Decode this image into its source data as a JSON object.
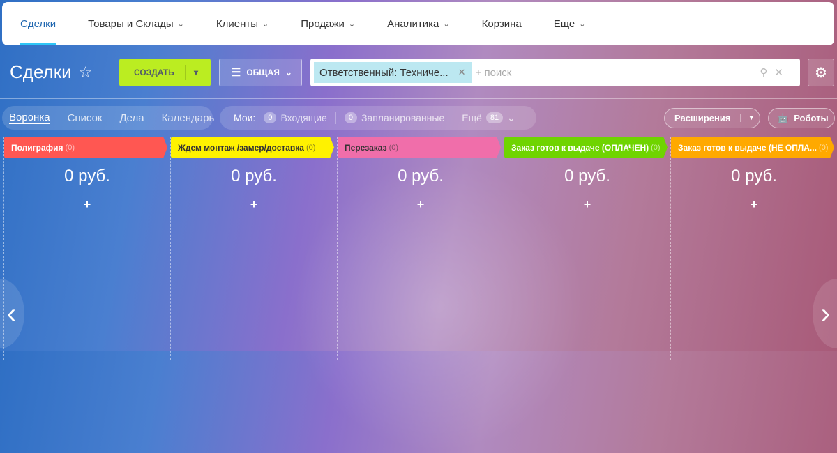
{
  "topnav": [
    {
      "label": "Сделки",
      "active": true,
      "dropdown": false
    },
    {
      "label": "Товары и Склады",
      "dropdown": true
    },
    {
      "label": "Клиенты",
      "dropdown": true
    },
    {
      "label": "Продажи",
      "dropdown": true
    },
    {
      "label": "Аналитика",
      "dropdown": true
    },
    {
      "label": "Корзина",
      "dropdown": false
    },
    {
      "label": "Еще",
      "dropdown": true
    }
  ],
  "page": {
    "title": "Сделки"
  },
  "toolbar": {
    "create_label": "СОЗДАТЬ",
    "filter_label": "ОБЩАЯ",
    "filter_tag": "Ответственный: Техниче...",
    "search_placeholder": "+ поиск"
  },
  "views": [
    "Воронка",
    "Список",
    "Дела",
    "Календарь"
  ],
  "counters": {
    "label": "Мои:",
    "incoming_count": "0",
    "incoming": "Входящие",
    "planned_count": "0",
    "planned": "Запланированные",
    "more": "Ещё",
    "more_count": "81"
  },
  "extensions_label": "Расширения",
  "robots_label": "Роботы",
  "stages": [
    {
      "name": "Полиграфия",
      "count": "(0)",
      "sum": "0 руб.",
      "color": "#ff5752",
      "text": "#ffffff"
    },
    {
      "name": "Ждем монтаж /замер/доставка",
      "count": "(0)",
      "sum": "0 руб.",
      "color": "#fff200",
      "text": "#333333"
    },
    {
      "name": "Перезаказ",
      "count": "(0)",
      "sum": "0 руб.",
      "color": "#f06eaa",
      "text": "#333333"
    },
    {
      "name": "Заказ готов к выдаче (ОПЛАЧЕН)",
      "count": "(0)",
      "sum": "0 руб.",
      "color": "#6fd400",
      "text": "#ffffff"
    },
    {
      "name": "Заказ готов к выдаче (НЕ ОПЛА...",
      "count": "(0)",
      "sum": "0 руб.",
      "color": "#ffa900",
      "text": "#ffffff"
    }
  ],
  "add_label": "+"
}
